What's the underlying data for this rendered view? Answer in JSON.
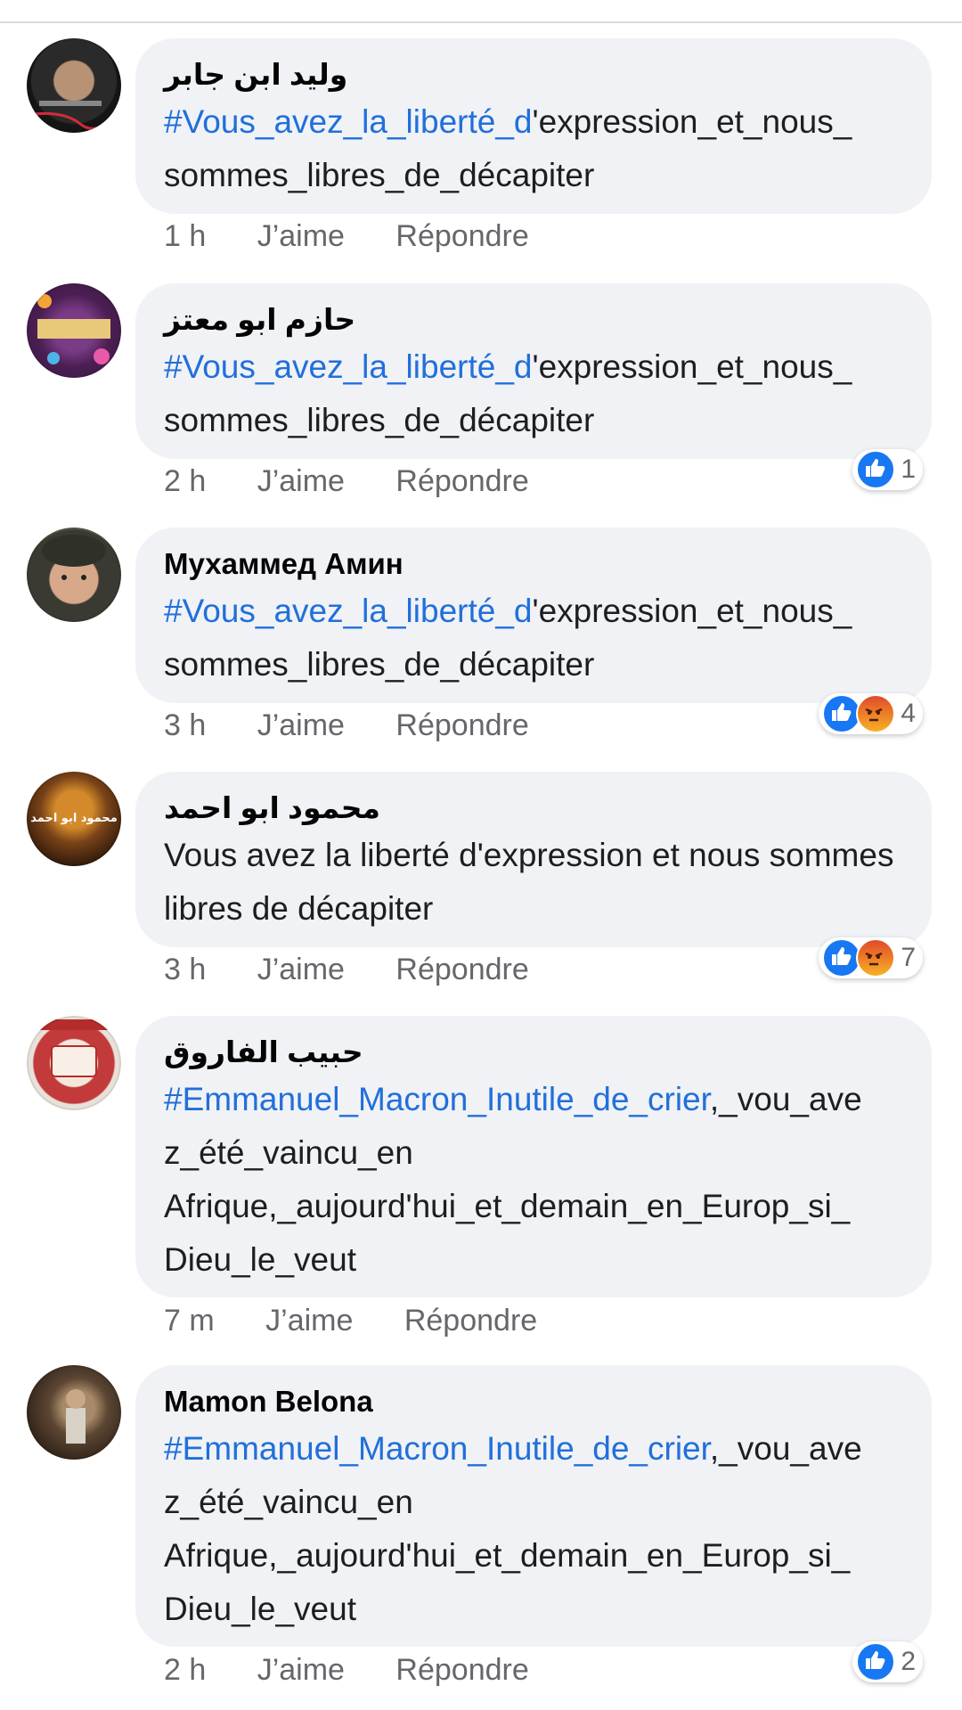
{
  "actions": {
    "like": "J’aime",
    "reply": "Répondre"
  },
  "comments": [
    {
      "author": "وليد ابن جابر",
      "hashtag": "#Vous_avez_la_liberté_d",
      "rest": "'expression_et_nous_ sommes_libres_de_décapiter",
      "time": "1 h",
      "reactions": null
    },
    {
      "author": "حازم ابو معتز",
      "hashtag": "#Vous_avez_la_liberté_d",
      "rest": "'expression_et_nous_ sommes_libres_de_décapiter",
      "time": "2 h",
      "reactions": {
        "count": "1",
        "types": [
          "like"
        ]
      }
    },
    {
      "author": "Мухаммед Амин",
      "hashtag": "#Vous_avez_la_liberté_d",
      "rest": "'expression_et_nous_ sommes_libres_de_décapiter",
      "time": "3 h",
      "reactions": {
        "count": "4",
        "types": [
          "like",
          "angry"
        ]
      }
    },
    {
      "author": "محمود ابو احمد",
      "hashtag": "",
      "rest": "Vous avez la liberté d'expression et nous sommes libres de décapiter",
      "time": "3 h",
      "reactions": {
        "count": "7",
        "types": [
          "like",
          "angry"
        ]
      }
    },
    {
      "author": "حبيب الفاروق",
      "hashtag": "#Emmanuel_Macron_Inutile_de_crier",
      "rest": ",_vou_ave z_été_vaincu_en Afrique,_aujourd'hui_et_demain_en_Europ_si_ Dieu_le_veut",
      "time": "7 m",
      "reactions": null
    },
    {
      "author": "Mamon Belona",
      "hashtag": "#Emmanuel_Macron_Inutile_de_crier",
      "rest": ",_vou_ave z_été_vaincu_en Afrique,_aujourd'hui_et_demain_en_Europ_si_ Dieu_le_veut",
      "time": "2 h",
      "reactions": {
        "count": "2",
        "types": [
          "like"
        ]
      }
    }
  ],
  "avatar_text": {
    "c4": "محمود ابو احمد"
  },
  "colors": {
    "hashtag": "#216fdb",
    "bubble": "#f0f2f5",
    "meta": "#65676b",
    "like": "#1877f2"
  }
}
